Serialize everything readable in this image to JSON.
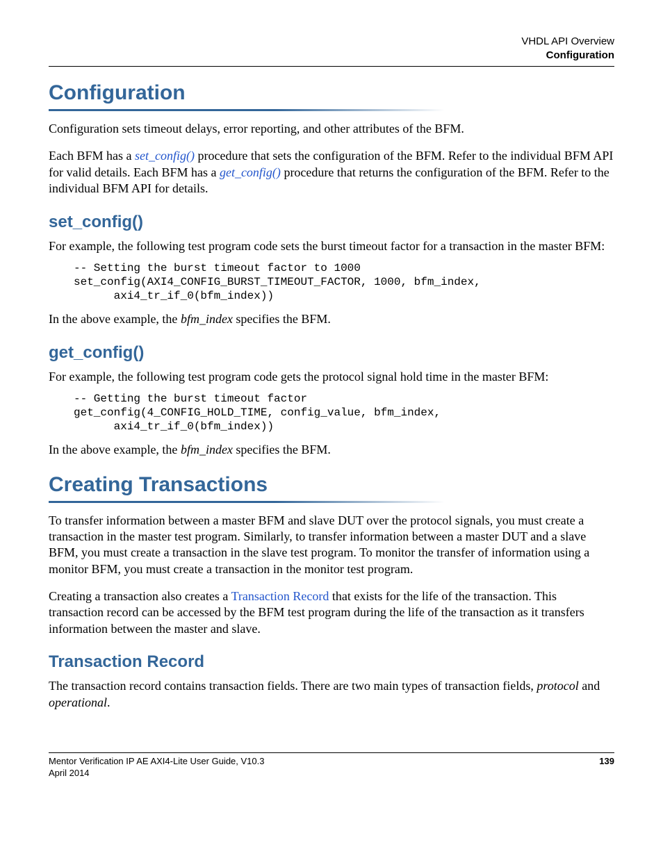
{
  "header": {
    "line1": "VHDL API Overview",
    "line2": "Configuration"
  },
  "configuration": {
    "heading": "Configuration",
    "para1": "Configuration sets timeout delays, error reporting, and other attributes of the BFM.",
    "para2_pre": "Each BFM has a ",
    "para2_link1": "set_config()",
    "para2_mid": " procedure that sets the configuration of the BFM. Refer to the individual BFM API for valid details. Each BFM has a ",
    "para2_link2": "get_config()",
    "para2_post": " procedure that returns the configuration of the BFM. Refer to the individual BFM API for details."
  },
  "set_config": {
    "heading": "set_config()",
    "para1": "For example, the following test program code sets the burst timeout factor for a transaction in the master BFM:",
    "code": "-- Setting the burst timeout factor to 1000\nset_config(AXI4_CONFIG_BURST_TIMEOUT_FACTOR, 1000, bfm_index,\n      axi4_tr_if_0(bfm_index))",
    "para2_pre": "In the above example, the ",
    "para2_em": "bfm_index",
    "para2_post": " specifies the BFM."
  },
  "get_config": {
    "heading": "get_config()",
    "para1": "For example, the following test program code gets the protocol signal hold time in the master BFM:",
    "code": "-- Getting the burst timeout factor\nget_config(4_CONFIG_HOLD_TIME, config_value, bfm_index,\n      axi4_tr_if_0(bfm_index))",
    "para2_pre": "In the above example, the ",
    "para2_em": "bfm_index",
    "para2_post": " specifies the BFM."
  },
  "creating": {
    "heading": "Creating Transactions",
    "para1": "To transfer information between a master BFM and slave DUT over the protocol signals, you must create a transaction in the master test program. Similarly, to transfer information between a master DUT and a slave BFM, you must create a transaction in the slave test program. To monitor the transfer of information using a monitor BFM, you must create a transaction in the monitor test program.",
    "para2_pre": "Creating a transaction also creates a ",
    "para2_link": "Transaction Record",
    "para2_post": " that exists for the life of the transaction. This transaction record can be accessed by the BFM test program during the life of the transaction as it transfers information between the master and slave."
  },
  "record": {
    "heading": "Transaction Record",
    "para1_pre": "The transaction record contains transaction fields. There are two main types of transaction fields, ",
    "para1_em1": "protocol",
    "para1_mid": " and ",
    "para1_em2": "operational",
    "para1_post": "."
  },
  "footer": {
    "guide": "Mentor Verification IP AE AXI4-Lite User Guide, V10.3",
    "page": "139",
    "date": "April 2014"
  }
}
